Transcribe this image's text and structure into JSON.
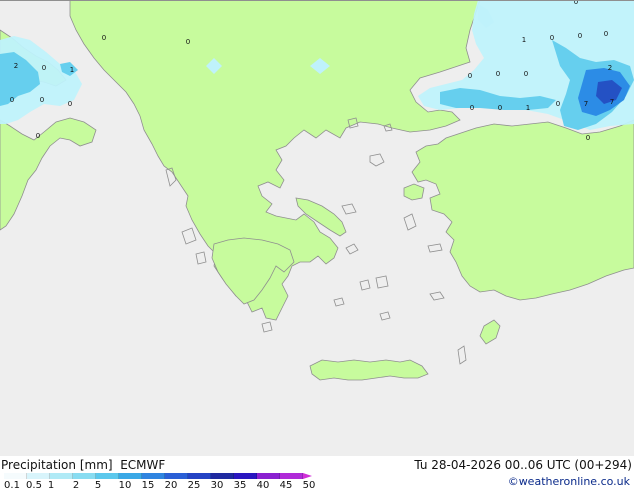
{
  "map": {
    "colors": {
      "sea": "#eeeeee",
      "land": "#c7fb9d",
      "coast": "#8f8f8f",
      "light_precip": "#bff2fb",
      "mid_precip": "#66cfee",
      "heavy_precip": "#2c8ce6",
      "very_heavy_precip": "#2451c4"
    },
    "point_labels": [
      {
        "id": "adriatic-1",
        "text": "2"
      },
      {
        "id": "adriatic-2",
        "text": "0"
      },
      {
        "id": "adriatic-3",
        "text": "1"
      },
      {
        "id": "adriatic-4",
        "text": "0"
      },
      {
        "id": "adriatic-5",
        "text": "0"
      },
      {
        "id": "italy-1",
        "text": "0"
      },
      {
        "id": "italy-2",
        "text": "0"
      },
      {
        "id": "balkans-1",
        "text": "0"
      },
      {
        "id": "balkans-2",
        "text": "0"
      },
      {
        "id": "blacksea-1",
        "text": "1"
      },
      {
        "id": "blacksea-2",
        "text": "0"
      },
      {
        "id": "blacksea-3",
        "text": "0"
      },
      {
        "id": "blacksea-4",
        "text": "0"
      },
      {
        "id": "thrace-1",
        "text": "0"
      },
      {
        "id": "thrace-2",
        "text": "0"
      },
      {
        "id": "thrace-3",
        "text": "0"
      },
      {
        "id": "marmara-1",
        "text": "0"
      },
      {
        "id": "marmara-2",
        "text": "0"
      },
      {
        "id": "marmara-3",
        "text": "1"
      },
      {
        "id": "marmara-4",
        "text": "0"
      },
      {
        "id": "anatolia-1",
        "text": "7"
      },
      {
        "id": "anatolia-2",
        "text": "7"
      },
      {
        "id": "anatolia-3",
        "text": "2"
      },
      {
        "id": "anatolia-4",
        "text": "0"
      },
      {
        "id": "top-1",
        "text": "0"
      }
    ]
  },
  "footer": {
    "left_title": "Precipitation [mm]  ECMWF",
    "right_title": "Tu 28-04-2026 00..06 UTC (00+294)",
    "credit": "©weatheronline.co.uk"
  },
  "scale": {
    "colors": [
      "#f5fbfd",
      "#d8f4fb",
      "#b0eaf6",
      "#88dcf1",
      "#5cc8ec",
      "#3aa8e6",
      "#2f84e0",
      "#2a5fd6",
      "#2443c4",
      "#1f2aa0",
      "#2a16c0",
      "#8a20d0",
      "#b02ad8",
      "#d030d8",
      "#e040d6"
    ],
    "ticks": [
      {
        "id": "t-0_1",
        "text": "0.1"
      },
      {
        "id": "t-0_5",
        "text": "0.5"
      },
      {
        "id": "t-1",
        "text": "1"
      },
      {
        "id": "t-2",
        "text": "2"
      },
      {
        "id": "t-5",
        "text": "5"
      },
      {
        "id": "t-10",
        "text": "10"
      },
      {
        "id": "t-15",
        "text": "15"
      },
      {
        "id": "t-20",
        "text": "20"
      },
      {
        "id": "t-25",
        "text": "25"
      },
      {
        "id": "t-30",
        "text": "30"
      },
      {
        "id": "t-35",
        "text": "35"
      },
      {
        "id": "t-40",
        "text": "40"
      },
      {
        "id": "t-45",
        "text": "45"
      },
      {
        "id": "t-50",
        "text": "50"
      }
    ]
  }
}
